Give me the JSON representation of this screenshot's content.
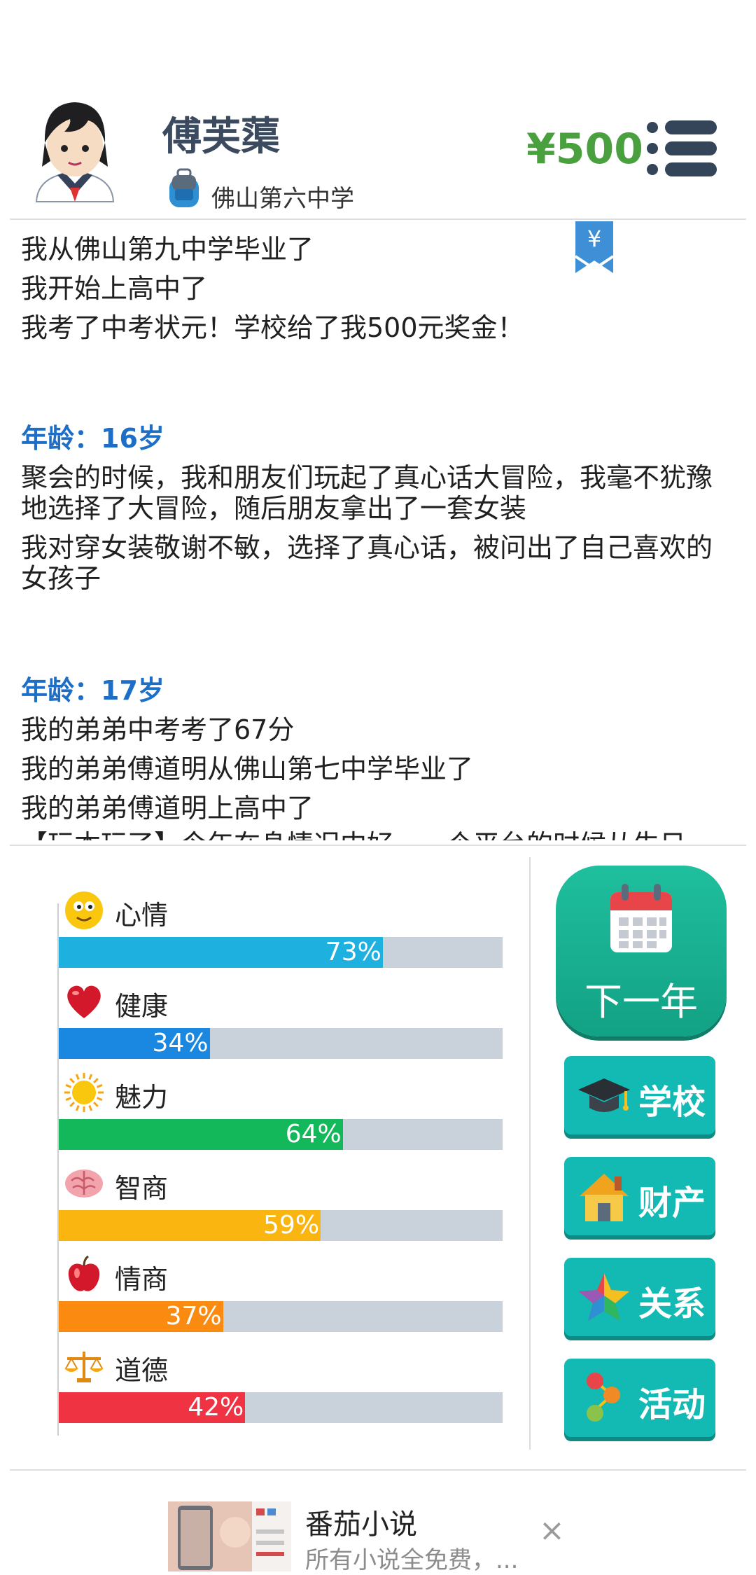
{
  "profile": {
    "name": "傅芙蕖",
    "school": "佛山第六中学",
    "money": "¥500",
    "avatar_icon": "student-avatar-icon",
    "school_icon": "backpack-icon",
    "menu_icon": "hamburger-menu-icon"
  },
  "log": {
    "bookmark_symbol": "¥",
    "lines": [
      {
        "text": "我从佛山第九中学毕业了",
        "age": false
      },
      {
        "text": "我开始上高中了",
        "age": false
      },
      {
        "text": "我考了中考状元！学校给了我500元奖金！",
        "age": false
      },
      {
        "text": "年龄：16岁",
        "age": true
      },
      {
        "text": "聚会的时候，我和朋友们玩起了真心话大冒险，我毫不犹豫地选择了大冒险，随后朋友拿出了一套女装",
        "age": false
      },
      {
        "text": "我对穿女装敬谢不敏，选择了真心话，被问出了自己喜欢的女孩子",
        "age": false
      },
      {
        "text": "年龄：17岁",
        "age": true
      },
      {
        "text": "我的弟弟中考考了67分",
        "age": false
      },
      {
        "text": "我的弟弟傅道明从佛山第七中学毕业了",
        "age": false
      },
      {
        "text": "我的弟弟傅道明上高中了",
        "age": false
      },
      {
        "text": "【玩本玩了】今年在身情况中好，一个平台的时候从生日",
        "age": false
      }
    ]
  },
  "stats": [
    {
      "label": "心情",
      "icon": "smiley-icon",
      "value": 73,
      "text": "73%",
      "color": "#1eb0de"
    },
    {
      "label": "健康",
      "icon": "heart-icon",
      "value": 34,
      "text": "34%",
      "color": "#1a87e0"
    },
    {
      "label": "魅力",
      "icon": "sun-icon",
      "value": 64,
      "text": "64%",
      "color": "#12b85a"
    },
    {
      "label": "智商",
      "icon": "brain-icon",
      "value": 59,
      "text": "59%",
      "color": "#fab510"
    },
    {
      "label": "情商",
      "icon": "apple-icon",
      "value": 37,
      "text": "37%",
      "color": "#fb8a10"
    },
    {
      "label": "道德",
      "icon": "scales-icon",
      "value": 42,
      "text": "42%",
      "color": "#ef3343"
    }
  ],
  "actions": {
    "next_year": "下一年",
    "next_year_icon": "calendar-icon",
    "school": "学校",
    "school_icon": "graduation-cap-icon",
    "property": "财产",
    "property_icon": "house-icon",
    "relations": "关系",
    "relations_icon": "star-icon",
    "activities": "活动",
    "activities_icon": "dots-icon"
  },
  "ad": {
    "title": "番茄小说",
    "subtitle": "所有小说全免费，...",
    "close": "×"
  }
}
